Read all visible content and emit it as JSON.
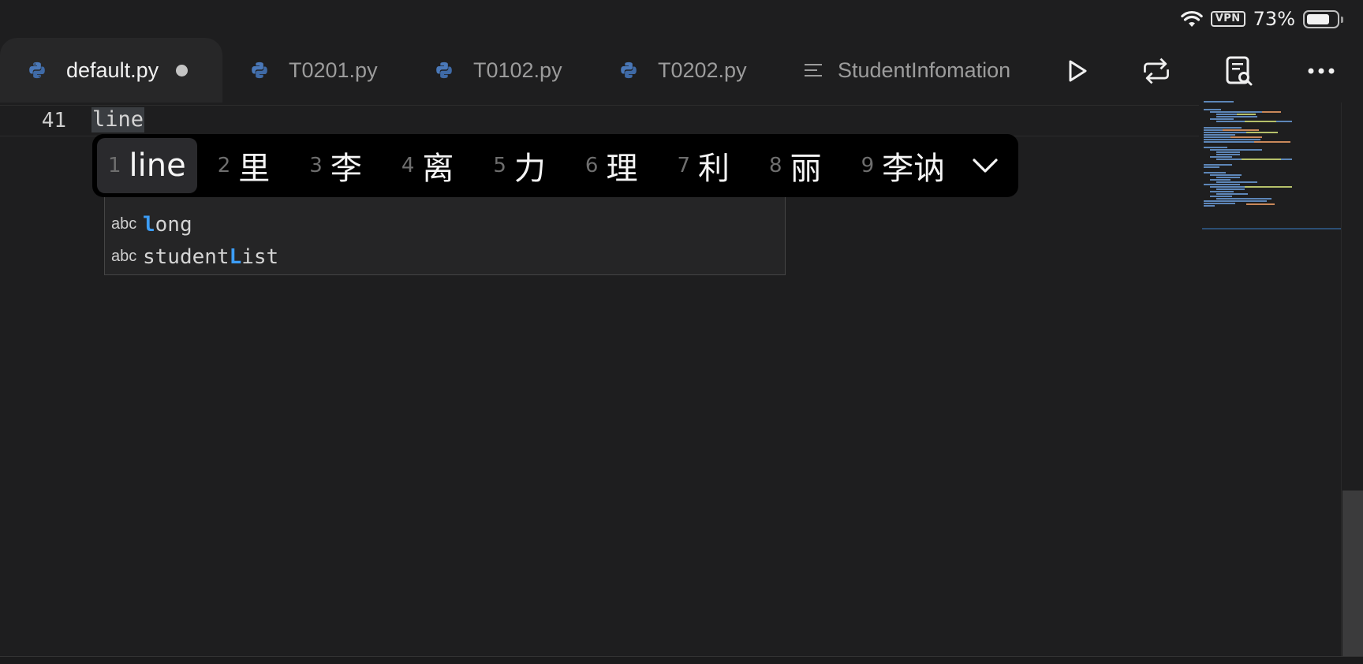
{
  "status_bar": {
    "wifi_icon": "wifi-icon",
    "vpn_label": "VPN",
    "battery_percent": "73%",
    "battery_level": 0.73
  },
  "tabs": [
    {
      "label": "default.py",
      "icon": "python-icon",
      "active": true,
      "modified": true
    },
    {
      "label": "T0201.py",
      "icon": "python-icon",
      "active": false
    },
    {
      "label": "T0102.py",
      "icon": "python-icon",
      "active": false
    },
    {
      "label": "T0202.py",
      "icon": "python-icon",
      "active": false
    },
    {
      "label": "StudentInfomation",
      "icon": "text-lines-icon",
      "active": false
    }
  ],
  "toolbar": {
    "run_icon": "play-icon",
    "sync_icon": "repeat-icon",
    "search_doc_icon": "document-search-icon",
    "more_icon": "more-icon"
  },
  "editor": {
    "line_number": "41",
    "line_text": "line"
  },
  "ime": {
    "candidates": [
      {
        "num": "1",
        "word": "line"
      },
      {
        "num": "2",
        "word": "里"
      },
      {
        "num": "3",
        "word": "李"
      },
      {
        "num": "4",
        "word": "离"
      },
      {
        "num": "5",
        "word": "力"
      },
      {
        "num": "6",
        "word": "理"
      },
      {
        "num": "7",
        "word": "利"
      },
      {
        "num": "8",
        "word": "丽"
      },
      {
        "num": "9",
        "word": "李讷"
      }
    ],
    "expand_icon": "chevron-down-icon"
  },
  "suggestions": [
    {
      "kind": "abc",
      "pre": "",
      "hl": "l",
      "post": "ong"
    },
    {
      "kind": "abc",
      "pre": "student",
      "hl": "L",
      "post": "ist"
    }
  ],
  "colors": {
    "background": "#1e1e1f",
    "match_highlight": "#3c9df6",
    "python_icon": "#4a78b8"
  }
}
